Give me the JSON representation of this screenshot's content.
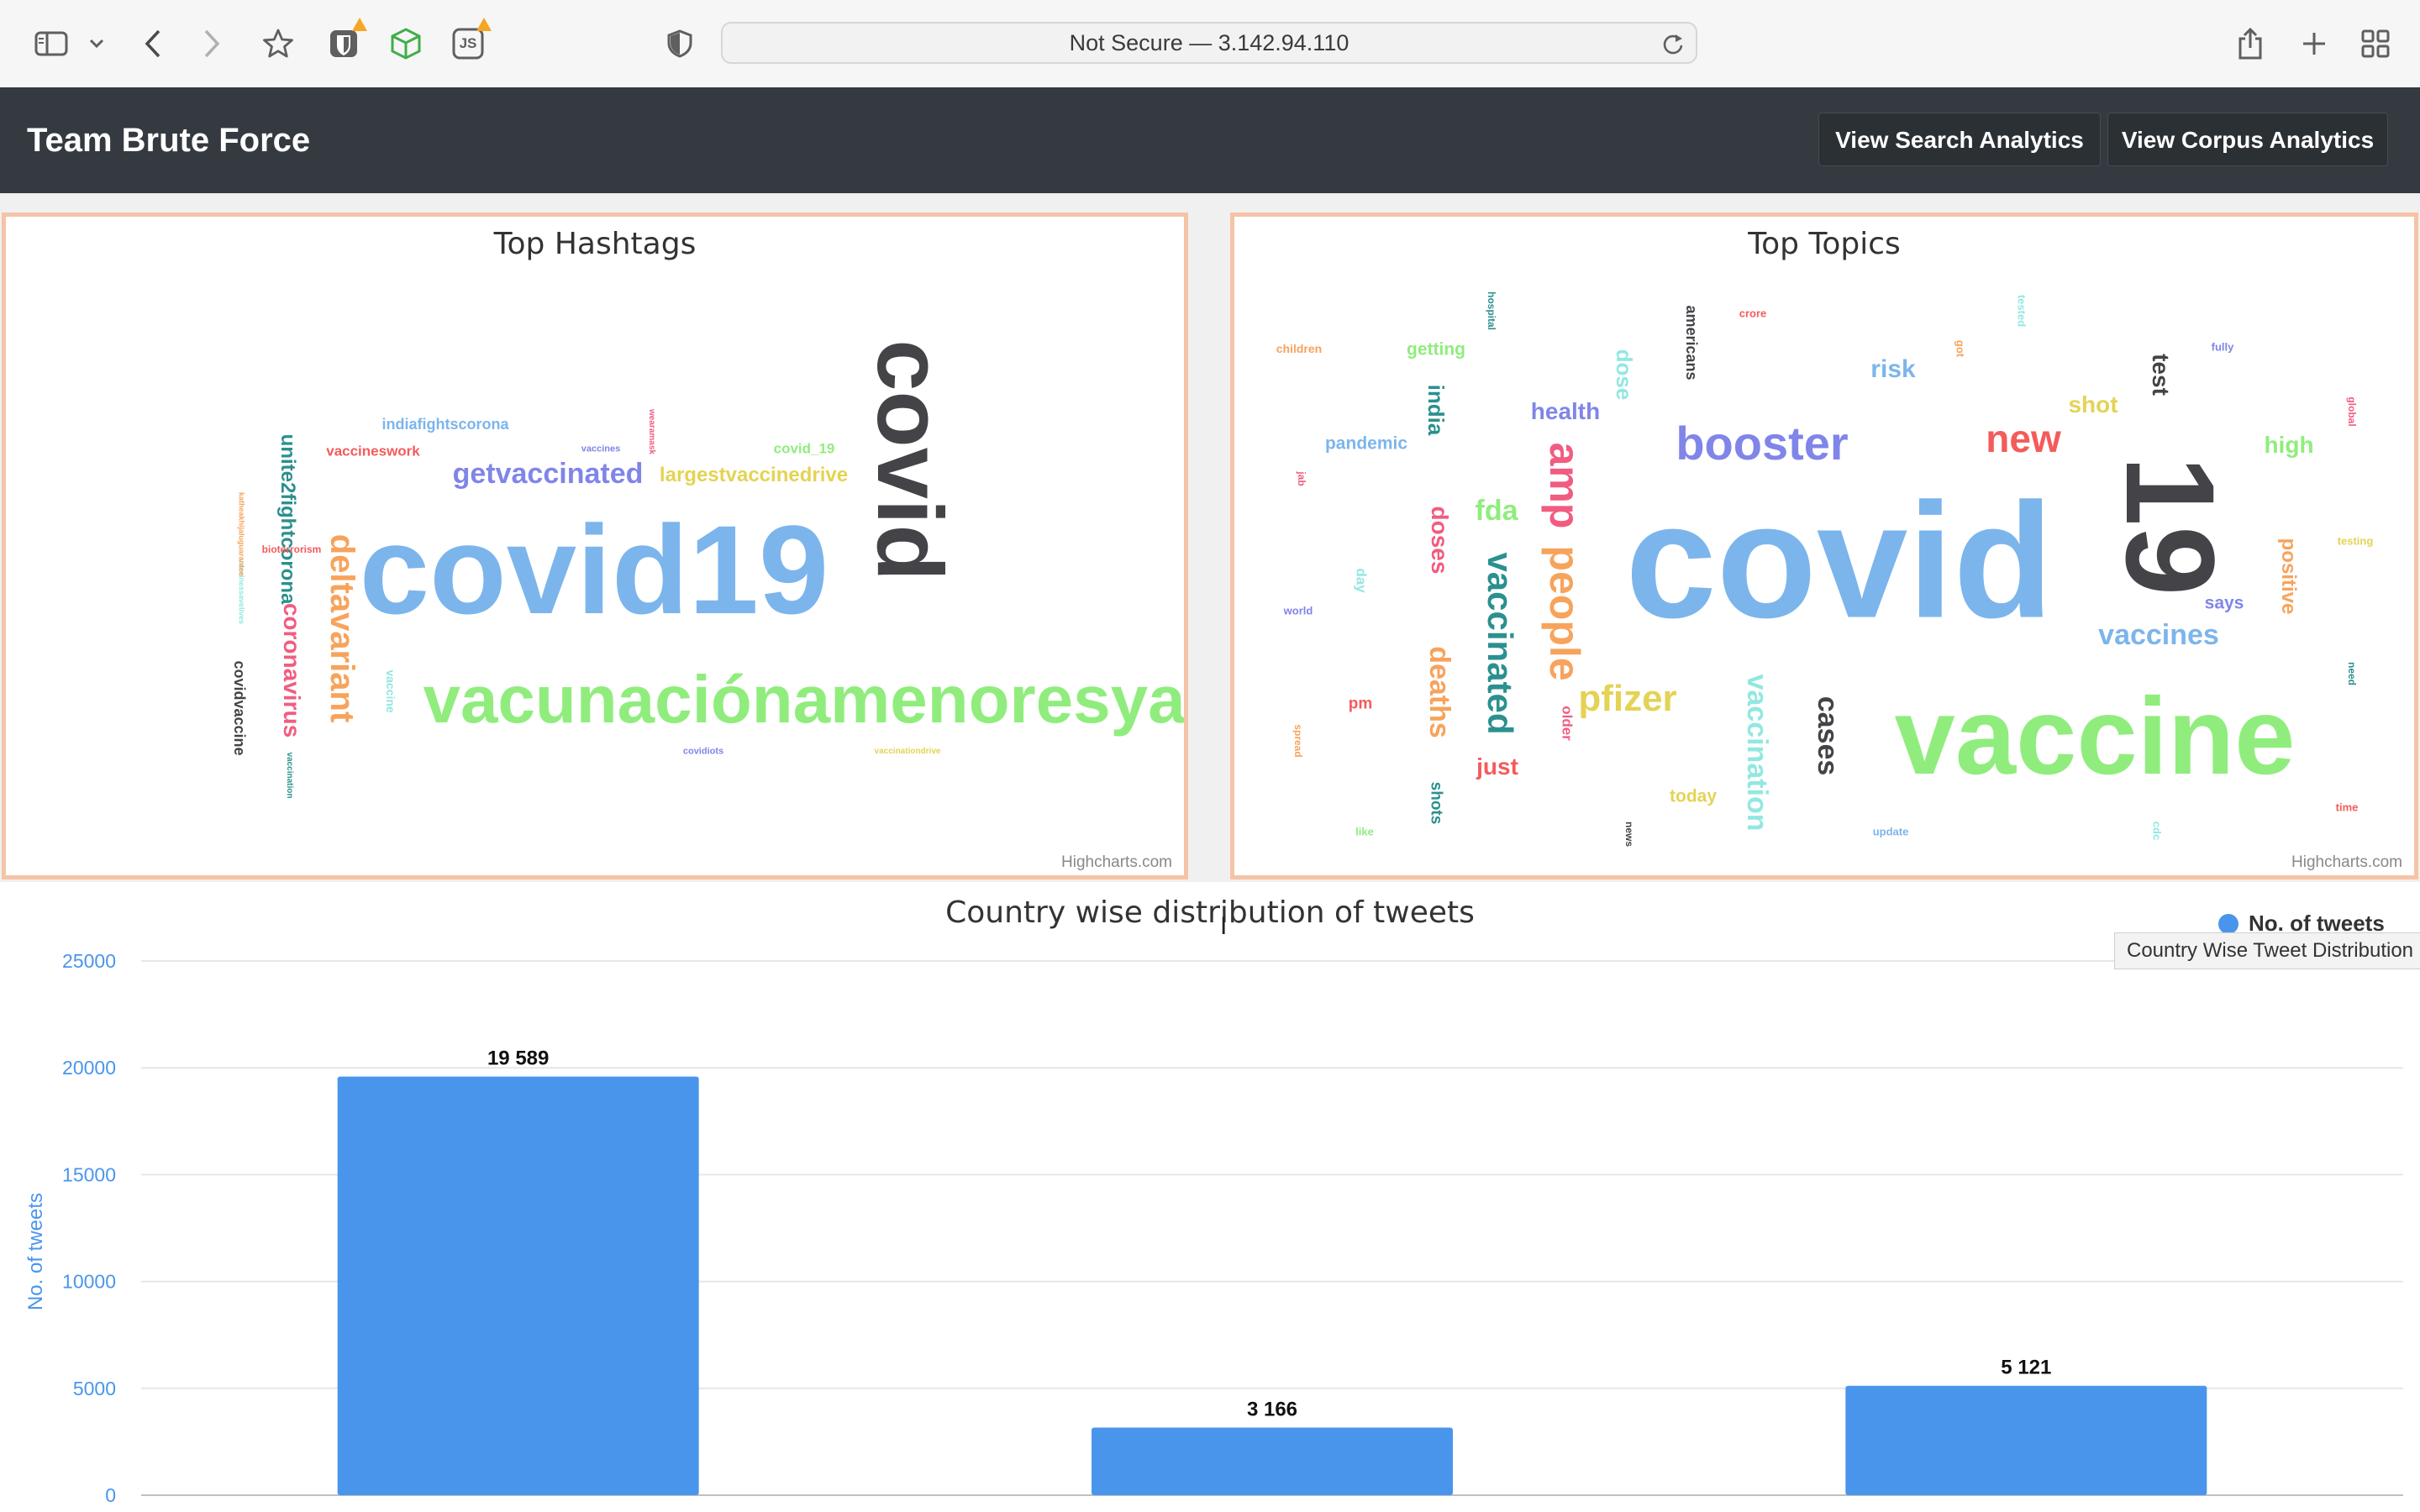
{
  "browser": {
    "url_text": "Not Secure — 3.142.94.110",
    "js_extension_label": "JS",
    "icons": [
      "sidebar-icon",
      "chevron-down-icon",
      "back-icon",
      "forward-icon",
      "bookmark-star-icon",
      "bitwarden-icon",
      "cube-extension-icon",
      "js-extension-icon",
      "privacy-shield-icon",
      "reload-icon",
      "share-icon",
      "new-tab-icon",
      "tab-overview-icon"
    ]
  },
  "navbar": {
    "brand": "Team Brute Force",
    "buttons": [
      "View Search Analytics",
      "View Corpus Analytics"
    ]
  },
  "hashtags_panel": {
    "title": "Top Hashtags",
    "credit": "Highcharts.com",
    "words": [
      {
        "text": "covid19",
        "color": "#7cb5ec",
        "size": 150,
        "rot": 0
      },
      {
        "text": "vacunaciónamenoresya",
        "color": "#90ed7d",
        "size": 80,
        "rot": 0
      },
      {
        "text": "covid",
        "color": "#434348",
        "size": 110,
        "rot": 90
      },
      {
        "text": "getvaccinated",
        "color": "#8085e9",
        "size": 34,
        "rot": 0
      },
      {
        "text": "largestvaccinedrive",
        "color": "#e4d354",
        "size": 24,
        "rot": 0
      },
      {
        "text": "deltavariant",
        "color": "#f7a35c",
        "size": 40,
        "rot": 90
      },
      {
        "text": "coronavirus",
        "color": "#f15c80",
        "size": 28,
        "rot": 90
      },
      {
        "text": "unite2fightcorona",
        "color": "#2b908f",
        "size": 24,
        "rot": 90
      },
      {
        "text": "indiafightscorona",
        "color": "#7cb5ec",
        "size": 18,
        "rot": 0
      },
      {
        "text": "vaccineswork",
        "color": "#f45b5b",
        "size": 17,
        "rot": 0
      },
      {
        "text": "covid_19",
        "color": "#90ed7d",
        "size": 17,
        "rot": 0
      },
      {
        "text": "covidvaccine",
        "color": "#434348",
        "size": 18,
        "rot": 90
      },
      {
        "text": "vaccines",
        "color": "#8085e9",
        "size": 11,
        "rot": 0
      },
      {
        "text": "wearamask",
        "color": "#f15c80",
        "size": 10,
        "rot": 90
      },
      {
        "text": "bioterrorism",
        "color": "#f45b5b",
        "size": 12,
        "rot": 0
      },
      {
        "text": "vaccine",
        "color": "#91e8e1",
        "size": 14,
        "rot": 90
      },
      {
        "text": "vaccination",
        "color": "#2b908f",
        "size": 10,
        "rot": 90
      },
      {
        "text": "covidiots",
        "color": "#8085e9",
        "size": 11,
        "rot": 0
      },
      {
        "text": "vaccinationdrive",
        "color": "#e4d354",
        "size": 10,
        "rot": 0
      },
      {
        "text": "vaccinessavelives",
        "color": "#91e8e1",
        "size": 9,
        "rot": 90
      },
      {
        "text": "katheakhijaluguarantee",
        "color": "#f7a35c",
        "size": 9,
        "rot": 90
      }
    ]
  },
  "topics_panel": {
    "title": "Top Topics",
    "credit": "Highcharts.com",
    "words": [
      {
        "text": "covid",
        "color": "#7cb5ec",
        "size": 195,
        "rot": 0
      },
      {
        "text": "vaccine",
        "color": "#90ed7d",
        "size": 130,
        "rot": 0
      },
      {
        "text": "19",
        "color": "#434348",
        "size": 150,
        "rot": 90
      },
      {
        "text": "booster",
        "color": "#8085e9",
        "size": 56,
        "rot": 0
      },
      {
        "text": "new",
        "color": "#f45b5b",
        "size": 46,
        "rot": 0
      },
      {
        "text": "people",
        "color": "#f7a35c",
        "size": 50,
        "rot": 90
      },
      {
        "text": "amp",
        "color": "#f15c80",
        "size": 50,
        "rot": 90
      },
      {
        "text": "vaccinated",
        "color": "#2b908f",
        "size": 42,
        "rot": 90
      },
      {
        "text": "pfizer",
        "color": "#e4d354",
        "size": 44,
        "rot": 0
      },
      {
        "text": "vaccination",
        "color": "#91e8e1",
        "size": 34,
        "rot": 90
      },
      {
        "text": "vaccines",
        "color": "#7cb5ec",
        "size": 34,
        "rot": 0
      },
      {
        "text": "cases",
        "color": "#434348",
        "size": 34,
        "rot": 90
      },
      {
        "text": "deaths",
        "color": "#f7a35c",
        "size": 34,
        "rot": 90
      },
      {
        "text": "doses",
        "color": "#f15c80",
        "size": 28,
        "rot": 90
      },
      {
        "text": "fda",
        "color": "#90ed7d",
        "size": 34,
        "rot": 0
      },
      {
        "text": "health",
        "color": "#8085e9",
        "size": 28,
        "rot": 0
      },
      {
        "text": "risk",
        "color": "#7cb5ec",
        "size": 30,
        "rot": 0
      },
      {
        "text": "shot",
        "color": "#e4d354",
        "size": 28,
        "rot": 0
      },
      {
        "text": "high",
        "color": "#90ed7d",
        "size": 28,
        "rot": 0
      },
      {
        "text": "positive",
        "color": "#f7a35c",
        "size": 24,
        "rot": 90
      },
      {
        "text": "test",
        "color": "#434348",
        "size": 28,
        "rot": 90
      },
      {
        "text": "india",
        "color": "#2b908f",
        "size": 26,
        "rot": 90
      },
      {
        "text": "just",
        "color": "#f45b5b",
        "size": 28,
        "rot": 0
      },
      {
        "text": "dose",
        "color": "#91e8e1",
        "size": 26,
        "rot": 90
      },
      {
        "text": "pandemic",
        "color": "#7cb5ec",
        "size": 21,
        "rot": 0
      },
      {
        "text": "getting",
        "color": "#90ed7d",
        "size": 21,
        "rot": 0
      },
      {
        "text": "americans",
        "color": "#434348",
        "size": 18,
        "rot": 90
      },
      {
        "text": "says",
        "color": "#8085e9",
        "size": 21,
        "rot": 0
      },
      {
        "text": "today",
        "color": "#e4d354",
        "size": 21,
        "rot": 0
      },
      {
        "text": "shots",
        "color": "#2b908f",
        "size": 19,
        "rot": 90
      },
      {
        "text": "older",
        "color": "#f15c80",
        "size": 17,
        "rot": 90
      },
      {
        "text": "pm",
        "color": "#f45b5b",
        "size": 19,
        "rot": 0
      },
      {
        "text": "day",
        "color": "#91e8e1",
        "size": 17,
        "rot": 90
      },
      {
        "text": "children",
        "color": "#f7a35c",
        "size": 14,
        "rot": 0
      },
      {
        "text": "hospital",
        "color": "#2b908f",
        "size": 12,
        "rot": 90
      },
      {
        "text": "crore",
        "color": "#f45b5b",
        "size": 13,
        "rot": 0
      },
      {
        "text": "tested",
        "color": "#91e8e1",
        "size": 13,
        "rot": 90
      },
      {
        "text": "got",
        "color": "#f7a35c",
        "size": 13,
        "rot": 90
      },
      {
        "text": "fully",
        "color": "#8085e9",
        "size": 13,
        "rot": 0
      },
      {
        "text": "global",
        "color": "#f15c80",
        "size": 12,
        "rot": 90
      },
      {
        "text": "jab",
        "color": "#f15c80",
        "size": 12,
        "rot": 90
      },
      {
        "text": "world",
        "color": "#8085e9",
        "size": 13,
        "rot": 0
      },
      {
        "text": "testing",
        "color": "#e4d354",
        "size": 13,
        "rot": 0
      },
      {
        "text": "need",
        "color": "#2b908f",
        "size": 12,
        "rot": 90
      },
      {
        "text": "spread",
        "color": "#f7a35c",
        "size": 12,
        "rot": 90
      },
      {
        "text": "time",
        "color": "#f45b5b",
        "size": 13,
        "rot": 0
      },
      {
        "text": "like",
        "color": "#90ed7d",
        "size": 13,
        "rot": 0
      },
      {
        "text": "news",
        "color": "#434348",
        "size": 12,
        "rot": 90
      },
      {
        "text": "update",
        "color": "#7cb5ec",
        "size": 13,
        "rot": 0
      },
      {
        "text": "cdc",
        "color": "#91e8e1",
        "size": 13,
        "rot": 90
      }
    ]
  },
  "chart_data": {
    "type": "bar",
    "title": "Country wise distribution of tweets",
    "xlabel": "",
    "ylabel": "No. of tweets",
    "ylim": [
      0,
      25000
    ],
    "yticks": [
      0,
      5000,
      10000,
      15000,
      20000,
      25000
    ],
    "categories": [
      "",
      "",
      ""
    ],
    "series": [
      {
        "name": "No. of tweets",
        "values": [
          19589,
          3166,
          5121
        ],
        "labels": [
          "19 589",
          "3 166",
          "5 121"
        ],
        "color": "#4a95ec"
      }
    ],
    "legend": "top-right",
    "grid": true
  },
  "tooltip": {
    "text": "Country Wise Tweet Distribution"
  }
}
